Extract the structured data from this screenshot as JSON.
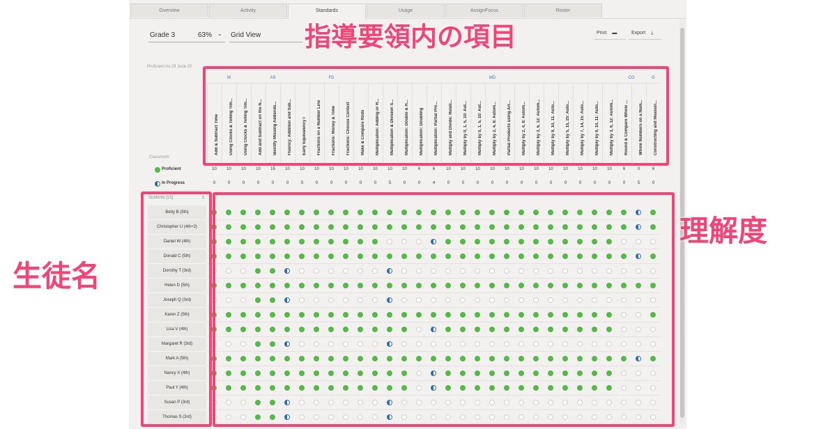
{
  "tabs": [
    "Overview",
    "Activity",
    "Standards",
    "Usage",
    "AssignFocus",
    "Roster"
  ],
  "active_tab": "Standards",
  "toolbar": {
    "grade": "Grade 3",
    "percent": "63%",
    "view": "Grid View",
    "print": "Print",
    "export": "Export"
  },
  "proficiency_label": "Proficient As Of June 22",
  "classroom_label": "Classroom",
  "students_label": "Students [15]",
  "legend": {
    "proficient": "Proficient",
    "in_progress": "In Progress"
  },
  "domains": [
    {
      "code": "M",
      "span": 3
    },
    {
      "code": "AS",
      "span": 3
    },
    {
      "code": "FD",
      "span": 5
    },
    {
      "code": "MD",
      "span": 17
    },
    {
      "code": "CO",
      "span": 2
    },
    {
      "code": "G",
      "span": 1
    }
  ],
  "standards": [
    "Add & Subtract Time",
    "Using Clocks & Telling Tim...",
    "Using Clocks & Telling Tim...",
    "Add and Subtract on the N...",
    "Identify Missing Addends...",
    "Fluency: Addition and Sub...",
    "Early Equivalency I",
    "Fractions on a Number Line",
    "Fractions: Money & Time",
    "Fractions: Choose Context",
    "Make & Compare Rods",
    "Multiplication: Adding or R...",
    "Multiplication & Division S...",
    "Multiplication: Double & H...",
    "Multiplication: Doubling",
    "Multiplication: Partial Pro...",
    "Multiply and Divide: Relati...",
    "Multiply by 0, 1, 5, 10: Aut...",
    "Multiply by 0, 1, 5, 10: Aut...",
    "Multiply by 2, 4, 8: Autom...",
    "Partial Products using Arr...",
    "Multiply by 2, 4, 8: Autom...",
    "Multiply by 3, 6, 12: Autom...",
    "Multiply by 9, 10, 11: Auto...",
    "Multiply by 5, 15, 25: Auto...",
    "Multiply by 7, 14, 15: Auto...",
    "Multiply by 9, 10, 11: Auto...",
    "Multiply by 3, 6, 12: Autom...",
    "Round & Compare Whole ...",
    "Whole Numbers on a Num...",
    "Constructing and Measuri..."
  ],
  "proficient_counts": [
    "10",
    "10",
    "10",
    "10",
    "15",
    "10",
    "10",
    "10",
    "10",
    "10",
    "10",
    "10",
    "10",
    "10",
    "6",
    "6",
    "10",
    "10",
    "10",
    "10",
    "10",
    "10",
    "10",
    "10",
    "10",
    "10",
    "10",
    "10",
    "6",
    "0",
    "6"
  ],
  "in_progress_counts": [
    "0",
    "0",
    "0",
    "0",
    "0",
    "0",
    "5",
    "0",
    "0",
    "0",
    "0",
    "0",
    "5",
    "0",
    "0",
    "4",
    "0",
    "0",
    "0",
    "0",
    "0",
    "0",
    "0",
    "0",
    "0",
    "0",
    "0",
    "0",
    "0",
    "5",
    "0"
  ],
  "students": [
    "Betty B (5th)",
    "Christopher U (4th+2)",
    "Daniel W (4th)",
    "Donald C (5th)",
    "Dorothy T (3rd)",
    "Helen D (5th)",
    "Joseph Q (3rd)",
    "Karen Z (5th)",
    "Lisa V (4th)",
    "Margaret R (3rd)",
    "Mark A (5th)",
    "Nancy X (4th)",
    "Paul Y (4th)",
    "Susan P (3rd)",
    "Thomas S (3rd)"
  ],
  "grid": [
    "ggggggggggggggggggggggggggggghg",
    "ggggggggggggggggggggggggggggghg",
    "ggggggggggggeeehggggggggggggeee",
    "ggggggggggggggggggggggggggggghg",
    "eeeggheeeeeeheeeeeeeeeeeeeeeeee",
    "ggggggggggggggggggggggggggggggg",
    "eeeggheeeeeeheeeeeeeeeeeeeeeeee",
    "ggggggggggggggggggggggggggggeeg",
    "ggggggggggggggehggggggggggggeee",
    "eeeggheeeeeeheeeeeeeeeeeeeeeeee",
    "ggggggggggggggggggggggggggggghg",
    "ggggggggggggggehggggggggggggeee",
    "ggggggggggggggehggggggggggggeee",
    "eeeggheeeeeeheeeeeeeeeeeeeeeeee",
    "eeeggheeeeeeheeeeeeeeeeeeeeeeee"
  ],
  "colors": {
    "proficient": "#56b847",
    "in_progress": "#2e6fa8",
    "highlight": "#f24577"
  },
  "annotations": {
    "standards": "指導要領内の項目",
    "students": "生徒名",
    "understanding": "理解度"
  }
}
